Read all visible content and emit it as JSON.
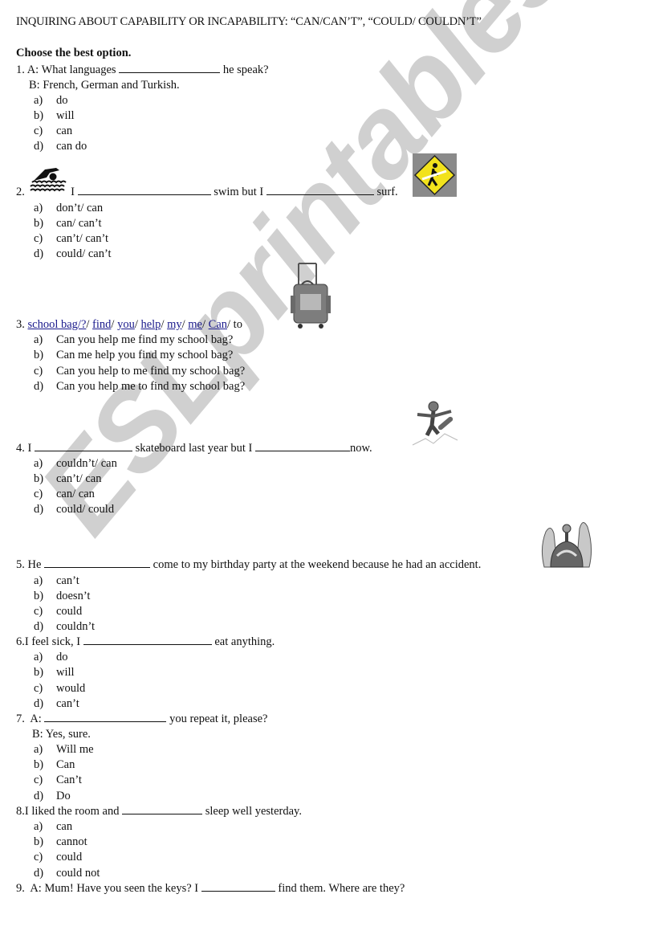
{
  "title": "INQUIRING ABOUT CAPABILITY OR INCAPABILITY: “CAN/CAN’T”, “COULD/ COULDN’T”",
  "instruction": "Choose the best option.",
  "watermark": "ESLprintables.com",
  "questions": [
    {
      "number": "1.",
      "line1_pre": "A: What languages",
      "line1_post": "he speak?",
      "line2": "B: French, German and Turkish.",
      "options": [
        {
          "letter": "a)",
          "text": "do"
        },
        {
          "letter": "b)",
          "text": "will"
        },
        {
          "letter": "c)",
          "text": "can"
        },
        {
          "letter": "d)",
          "text": "can do"
        }
      ]
    },
    {
      "number": "2.",
      "pre": "I",
      "mid": "swim but I",
      "post": "surf.",
      "options": [
        {
          "letter": "a)",
          "text": "don’t/ can"
        },
        {
          "letter": "b)",
          "text": "can/ can’t"
        },
        {
          "letter": "c)",
          "text": "can’t/ can’t"
        },
        {
          "letter": "d)",
          "text": "could/ can’t"
        }
      ]
    },
    {
      "number": "3.",
      "words": [
        "school bag/?",
        "find",
        "you",
        "help",
        "my",
        "me",
        "Can"
      ],
      "tail": "to",
      "options": [
        {
          "letter": "a)",
          "text": "Can you help me find my school bag?"
        },
        {
          "letter": "b)",
          "text": "Can me help you find my school bag?"
        },
        {
          "letter": "c)",
          "text": "Can you help to me find my school bag?"
        },
        {
          "letter": "d)",
          "text": "Can you help me to find my school bag?"
        }
      ]
    },
    {
      "number": "4.",
      "pre": "I",
      "mid": "skateboard last year but I",
      "post": "now.",
      "options": [
        {
          "letter": "a)",
          "text": "couldn’t/ can"
        },
        {
          "letter": "b)",
          "text": "can’t/ can"
        },
        {
          "letter": "c)",
          "text": "can/ can"
        },
        {
          "letter": "d)",
          "text": "could/ could"
        }
      ]
    },
    {
      "number": "5.",
      "pre": "He",
      "post": "come to my birthday party at the weekend because he had an accident.",
      "options": [
        {
          "letter": "a)",
          "text": "can’t"
        },
        {
          "letter": "b)",
          "text": "doesn’t"
        },
        {
          "letter": "c)",
          "text": "could"
        },
        {
          "letter": "d)",
          "text": "couldn’t"
        }
      ]
    },
    {
      "number": "6.",
      "pre": "I feel sick, I",
      "post": "eat anything.",
      "options": [
        {
          "letter": "a)",
          "text": "do"
        },
        {
          "letter": "b)",
          "text": "will"
        },
        {
          "letter": "c)",
          "text": "would"
        },
        {
          "letter": "d)",
          "text": "can’t"
        }
      ]
    },
    {
      "number": "7.",
      "pre": "A:",
      "post": "you repeat it, please?",
      "line2": "B:  Yes, sure.",
      "options": [
        {
          "letter": "a)",
          "text": "Will me"
        },
        {
          "letter": "b)",
          "text": "Can"
        },
        {
          "letter": "c)",
          "text": "Can’t"
        },
        {
          "letter": "d)",
          "text": "Do"
        }
      ]
    },
    {
      "number": "8.",
      "pre": "I liked the room and",
      "post": "sleep well yesterday.",
      "options": [
        {
          "letter": "a)",
          "text": "can"
        },
        {
          "letter": "b)",
          "text": "cannot"
        },
        {
          "letter": "c)",
          "text": "could"
        },
        {
          "letter": "d)",
          "text": "could not"
        }
      ]
    },
    {
      "number": "9.",
      "pre": "A: Mum! Have you seen the keys? I",
      "post": "find them. Where are they?"
    }
  ]
}
